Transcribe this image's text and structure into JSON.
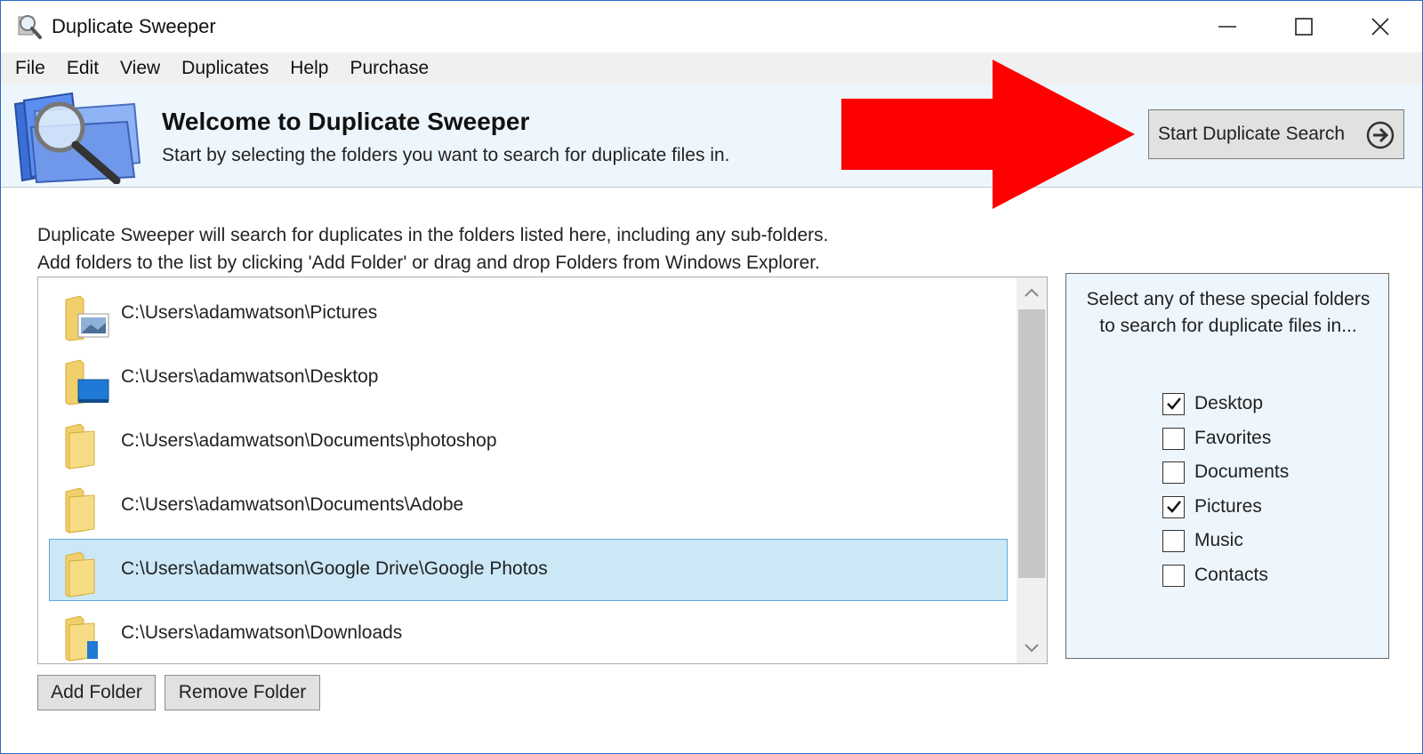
{
  "window": {
    "title": "Duplicate Sweeper"
  },
  "menu": [
    "File",
    "Edit",
    "View",
    "Duplicates",
    "Help",
    "Purchase"
  ],
  "banner": {
    "title": "Welcome to Duplicate Sweeper",
    "subtitle": "Start by selecting the folders you want to search for duplicate files in.",
    "start_button": "Start Duplicate Search"
  },
  "info": {
    "line1": "Duplicate Sweeper will search for duplicates in the folders listed here, including any sub-folders.",
    "line2": "Add folders to the list by clicking 'Add Folder' or drag and drop Folders from Windows Explorer."
  },
  "folders": [
    {
      "path": "C:\\Users\\adamwatson\\Pictures",
      "icon": "pictures-folder-icon",
      "selected": false
    },
    {
      "path": "C:\\Users\\adamwatson\\Desktop",
      "icon": "desktop-folder-icon",
      "selected": false
    },
    {
      "path": "C:\\Users\\adamwatson\\Documents\\photoshop",
      "icon": "folder-icon",
      "selected": false
    },
    {
      "path": "C:\\Users\\adamwatson\\Documents\\Adobe",
      "icon": "folder-icon",
      "selected": false
    },
    {
      "path": "C:\\Users\\adamwatson\\Google Drive\\Google Photos",
      "icon": "folder-icon",
      "selected": true
    },
    {
      "path": "C:\\Users\\adamwatson\\Downloads",
      "icon": "downloads-folder-icon",
      "selected": false
    }
  ],
  "buttons": {
    "add_folder": "Add Folder",
    "remove_folder": "Remove Folder"
  },
  "special": {
    "title": "Select any of these special folders to search for duplicate files in...",
    "items": [
      {
        "label": "Desktop",
        "checked": true
      },
      {
        "label": "Favorites",
        "checked": false
      },
      {
        "label": "Documents",
        "checked": false
      },
      {
        "label": "Pictures",
        "checked": true
      },
      {
        "label": "Music",
        "checked": false
      },
      {
        "label": "Contacts",
        "checked": false
      }
    ]
  },
  "colors": {
    "selection_bg": "#cce8f7",
    "banner_bg": "#eef6fd",
    "arrow": "#ff0000"
  }
}
